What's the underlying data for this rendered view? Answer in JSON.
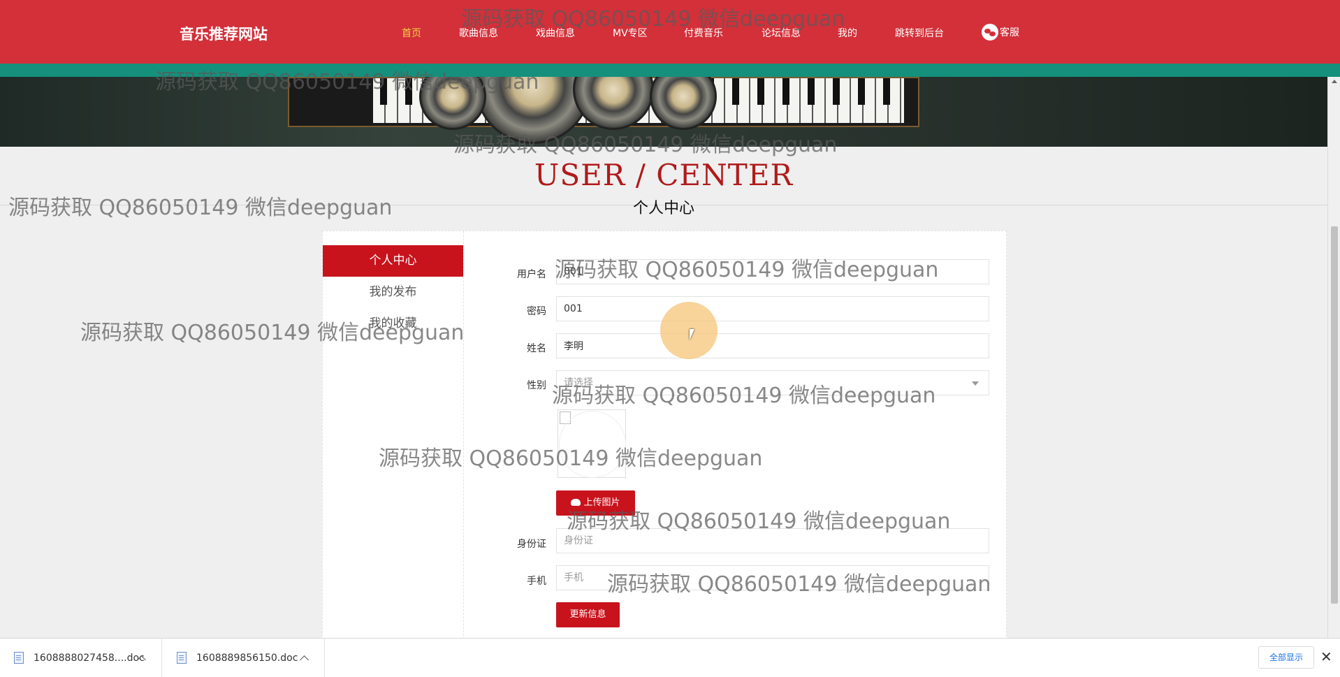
{
  "nav": {
    "brand": "音乐推荐网站",
    "links": [
      "首页",
      "歌曲信息",
      "戏曲信息",
      "MV专区",
      "付费音乐",
      "论坛信息",
      "我的",
      "跳转到后台"
    ],
    "kefu": "客服",
    "accent_color": "#d3303a",
    "active_color": "#f5d14a"
  },
  "section": {
    "title_en": "USER / CENTER",
    "title_cn": "个人中心"
  },
  "sidebar": {
    "items": [
      "个人中心",
      "我的发布",
      "我的收藏"
    ]
  },
  "form": {
    "username": {
      "label": "用户名",
      "value": "001"
    },
    "password": {
      "label": "密码",
      "value": "001"
    },
    "name": {
      "label": "姓名",
      "value": "李明"
    },
    "gender": {
      "label": "性别",
      "placeholder": "请选择"
    },
    "upload_label": "上传图片",
    "idcard": {
      "label": "身份证",
      "placeholder": "身份证"
    },
    "phone": {
      "label": "手机",
      "placeholder": "手机"
    },
    "submit_label": "更新信息"
  },
  "downloads": {
    "items": [
      "1608888027458....doc",
      "1608889856150.doc"
    ],
    "show_all": "全部显示"
  },
  "watermark": "源码获取 QQ86050149 微信deepguan"
}
